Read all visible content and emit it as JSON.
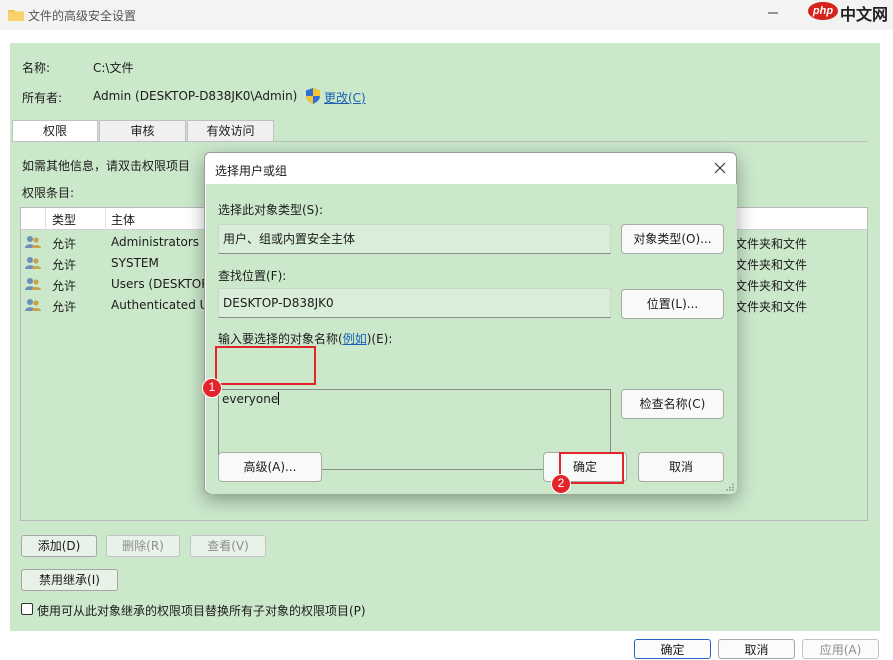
{
  "window": {
    "title": "文件的高级安全设置"
  },
  "watermark": {
    "mark": "php",
    "text": "中文网"
  },
  "info": {
    "name_label": "名称:",
    "name_value": "C:\\文件",
    "owner_label": "所有者:",
    "owner_value": "Admin (DESKTOP-D838JK0\\Admin)",
    "change_link": "更改(C)"
  },
  "tabs": [
    {
      "label": "权限",
      "active": true
    },
    {
      "label": "审核",
      "active": false
    },
    {
      "label": "有效访问",
      "active": false
    }
  ],
  "instruction_text": "如需其他信息，请双击权限项目",
  "entries_label": "权限条目:",
  "perm_table": {
    "columns": [
      "类型",
      "主体"
    ],
    "rows": [
      {
        "type": "允许",
        "principal": "Administrators (",
        "applies": "文件夹和文件"
      },
      {
        "type": "允许",
        "principal": "SYSTEM",
        "applies": "文件夹和文件"
      },
      {
        "type": "允许",
        "principal": "Users (DESKTOP",
        "applies": "文件夹和文件"
      },
      {
        "type": "允许",
        "principal": "Authenticated U",
        "applies": "文件夹和文件"
      }
    ]
  },
  "actions": {
    "add": "添加(D)",
    "remove": "删除(R)",
    "view": "查看(V)"
  },
  "disable_inheritance": "禁用继承(I)",
  "replace_checkbox": {
    "label": "使用可从此对象继承的权限项目替换所有子对象的权限项目(P)",
    "checked": false
  },
  "bottom": {
    "ok": "确定",
    "cancel": "取消",
    "apply": "应用(A)"
  },
  "dialog": {
    "title": "选择用户或组",
    "object_type_label": "选择此对象类型(S):",
    "object_type_value": "用户、组或内置安全主体",
    "object_types_button": "对象类型(O)...",
    "location_label": "查找位置(F):",
    "location_value": "DESKTOP-D838JK0",
    "location_button": "位置(L)...",
    "names_label_pre": "输入要选择的对象名称(",
    "names_label_link": "例如",
    "names_label_post": ")(E):",
    "names_value": "everyone",
    "check_names_button": "检查名称(C)",
    "advanced_button": "高级(A)...",
    "ok_button": "确定",
    "cancel_button": "取消"
  },
  "annotations": {
    "step1": "1",
    "step2": "2",
    "color": "#e3252b"
  }
}
